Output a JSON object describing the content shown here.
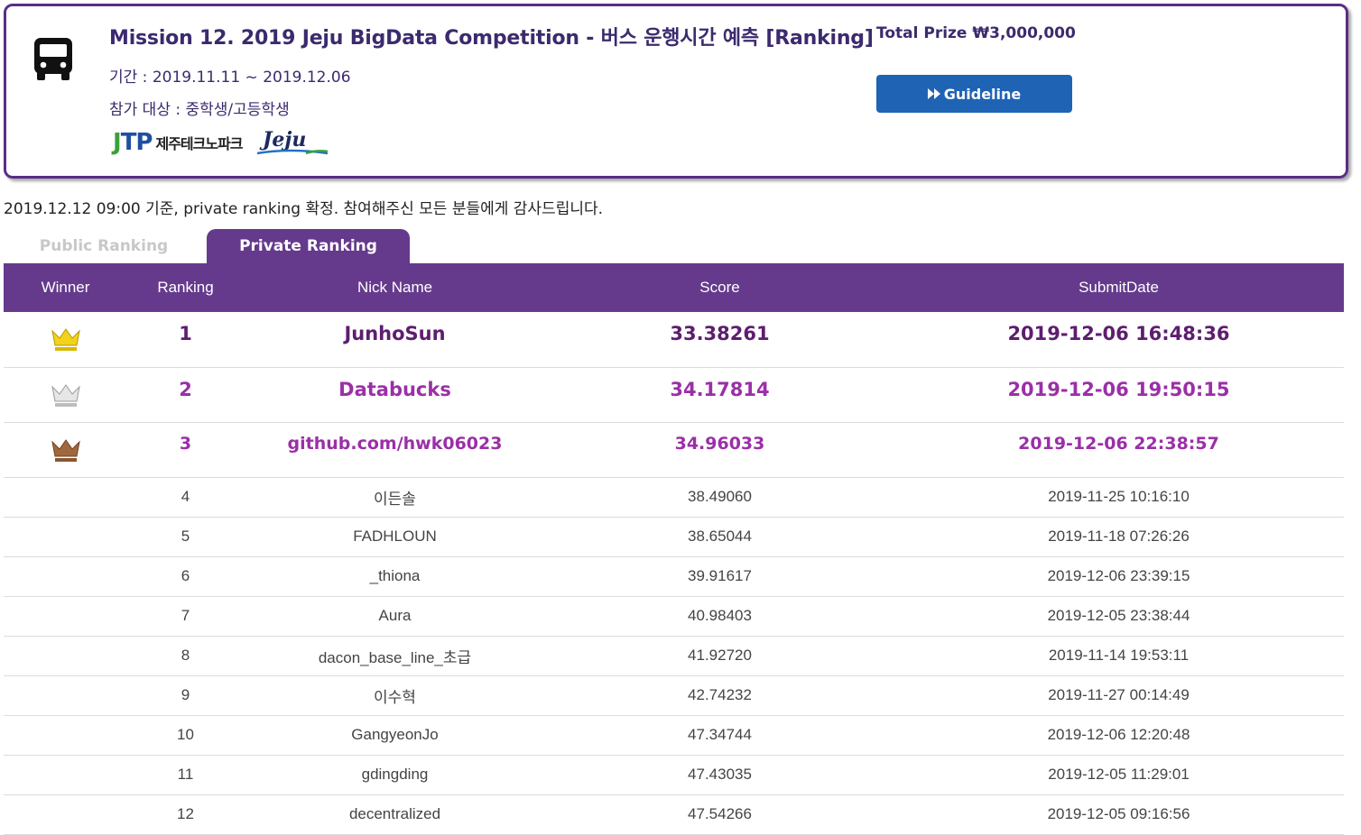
{
  "header": {
    "title": "Mission 12. 2019 Jeju BigData Competition - 버스 운행시간 예측  [Ranking]",
    "period": "기간 : 2019.11.11 ~ 2019.12.06",
    "target": "참가 대상 : 중학생/고등학생",
    "logo_jtp": "JTP",
    "logo_jtp_name": "제주테크노파크",
    "logo_jeju": "Jeju",
    "prize": "Total Prize ₩3,000,000",
    "guideline_label": "Guideline",
    "icons": {
      "main": "bus-icon",
      "button": "fast-forward-icon"
    }
  },
  "notice": "2019.12.12 09:00 기준, private ranking 확정. 참여해주신 모든 분들에게 감사드립니다.",
  "tabs": [
    {
      "label": "Public Ranking",
      "active": false
    },
    {
      "label": "Private Ranking",
      "active": true
    }
  ],
  "table": {
    "columns": [
      "Winner",
      "Ranking",
      "Nick Name",
      "Score",
      "SubmitDate"
    ],
    "rows": [
      {
        "rank": "1",
        "nick": "JunhoSun",
        "score": "33.38261",
        "date": "2019-12-06 16:48:36",
        "crown": "gold"
      },
      {
        "rank": "2",
        "nick": "Databucks",
        "score": "34.17814",
        "date": "2019-12-06 19:50:15",
        "crown": "silver"
      },
      {
        "rank": "3",
        "nick": "github.com/hwk06023",
        "score": "34.96033",
        "date": "2019-12-06 22:38:57",
        "crown": "bronze"
      },
      {
        "rank": "4",
        "nick": "이든솔",
        "score": "38.49060",
        "date": "2019-11-25 10:16:10"
      },
      {
        "rank": "5",
        "nick": "FADHLOUN",
        "score": "38.65044",
        "date": "2019-11-18 07:26:26"
      },
      {
        "rank": "6",
        "nick": "_thiona",
        "score": "39.91617",
        "date": "2019-12-06 23:39:15"
      },
      {
        "rank": "7",
        "nick": "Aura",
        "score": "40.98403",
        "date": "2019-12-05 23:38:44"
      },
      {
        "rank": "8",
        "nick": "dacon_base_line_초급",
        "score": "41.92720",
        "date": "2019-11-14 19:53:11"
      },
      {
        "rank": "9",
        "nick": "이수혁",
        "score": "42.74232",
        "date": "2019-11-27 00:14:49"
      },
      {
        "rank": "10",
        "nick": "GangyeonJo",
        "score": "47.34744",
        "date": "2019-12-06 12:20:48"
      },
      {
        "rank": "11",
        "nick": "gdingding",
        "score": "47.43035",
        "date": "2019-12-05 11:29:01"
      },
      {
        "rank": "12",
        "nick": "decentralized",
        "score": "47.54266",
        "date": "2019-12-05 09:16:56"
      }
    ]
  },
  "colors": {
    "accent_purple": "#653a8c",
    "title_text": "#3c2a6e",
    "button_blue": "#1f63b5",
    "gold": "#f2d21a",
    "silver": "#d4d4d4",
    "bronze": "#a0683e"
  }
}
